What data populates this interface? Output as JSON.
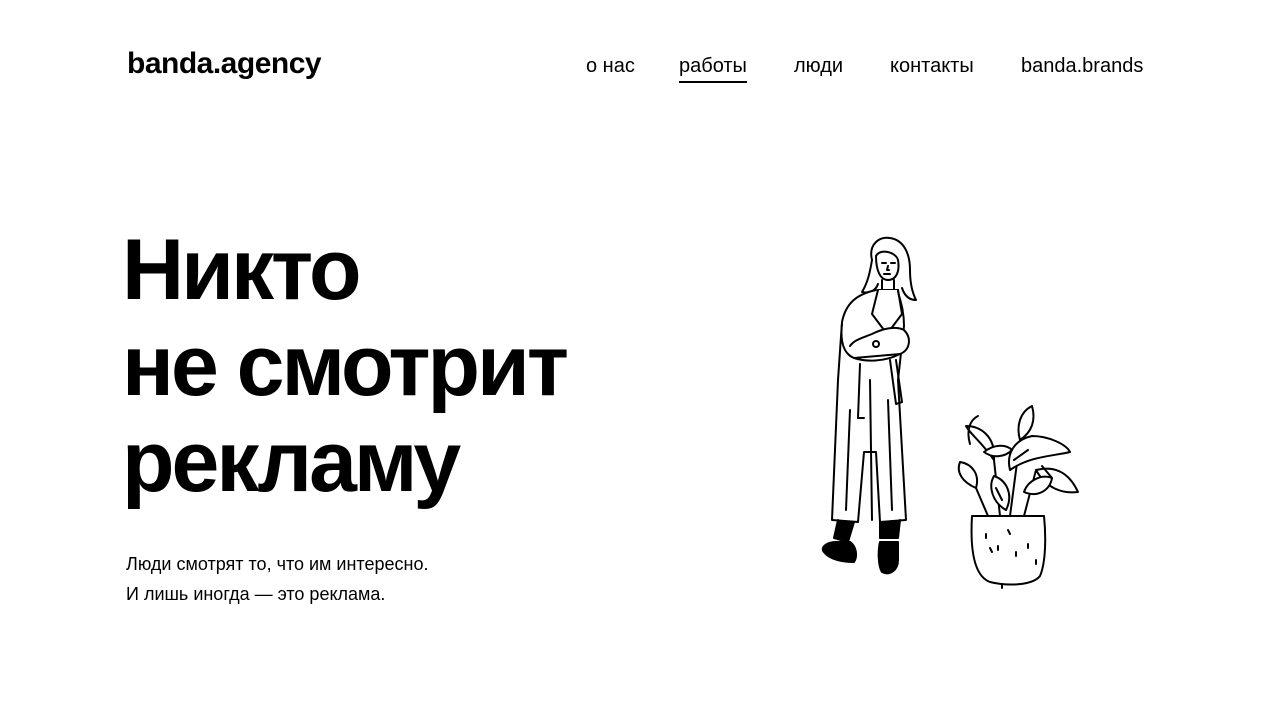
{
  "header": {
    "logo": "banda.agency",
    "nav": [
      {
        "label": "о нас",
        "active": false
      },
      {
        "label": "работы",
        "active": true
      },
      {
        "label": "люди",
        "active": false
      },
      {
        "label": "контакты",
        "active": false
      },
      {
        "label": "banda.brands",
        "active": false
      }
    ]
  },
  "hero": {
    "headline_lines": [
      "Никто",
      "не смотрит",
      "рекламу"
    ],
    "subtext_lines": [
      "Люди смотрят то, что им интересно.",
      "И лишь иногда — это реклама."
    ]
  },
  "colors": {
    "background": "#ffffff",
    "text": "#000000"
  },
  "illustration": {
    "icons": [
      "woman-in-coat-illustration",
      "potted-plant-illustration"
    ]
  }
}
